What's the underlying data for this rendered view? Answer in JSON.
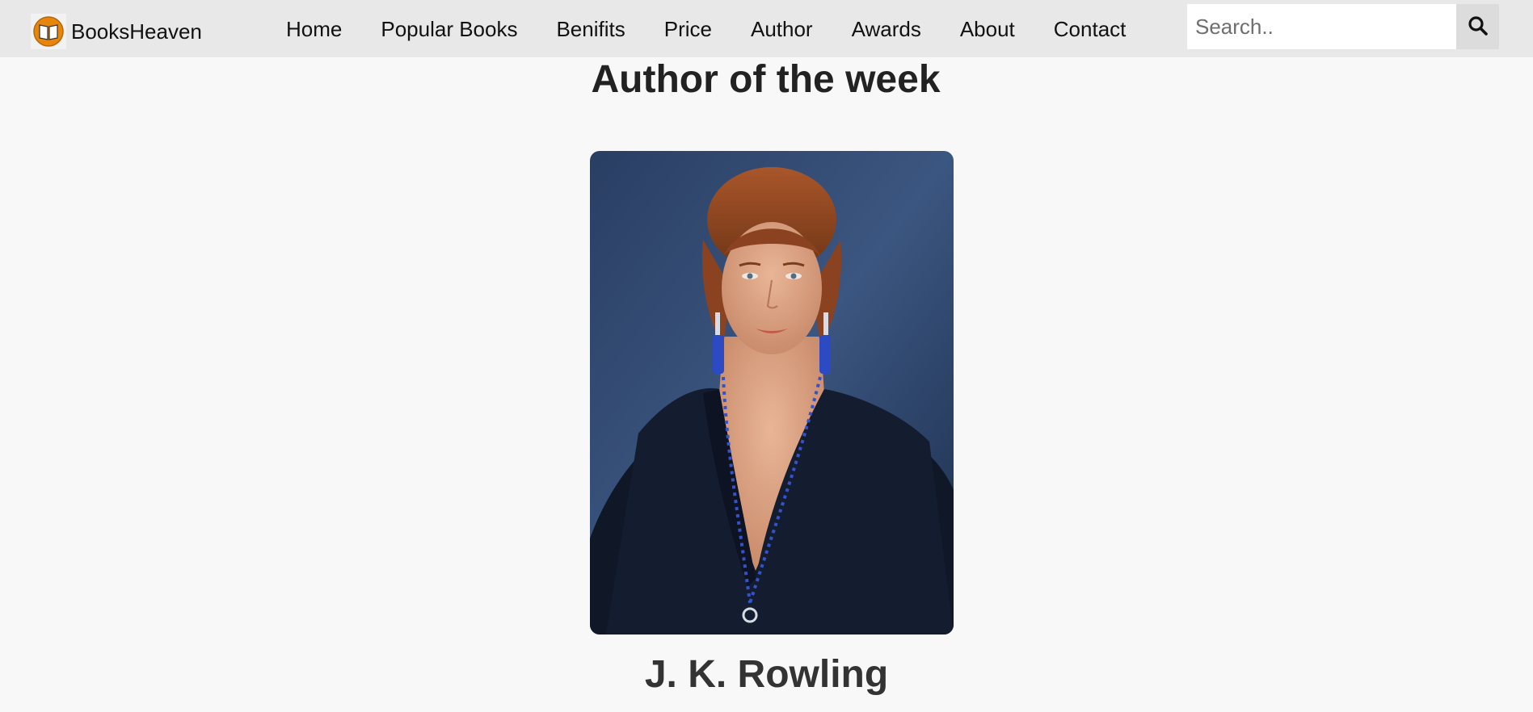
{
  "navbar": {
    "brand": {
      "name": "BooksHeaven",
      "logo_icon": "open-book-icon"
    },
    "links": [
      {
        "label": "Home"
      },
      {
        "label": "Popular Books"
      },
      {
        "label": "Benifits"
      },
      {
        "label": "Price"
      },
      {
        "label": "Author"
      },
      {
        "label": "Awards"
      },
      {
        "label": "About"
      },
      {
        "label": "Contact"
      }
    ],
    "search": {
      "value": "",
      "placeholder": "Search..",
      "button_icon": "search-icon"
    }
  },
  "author_section": {
    "title": "Author of the week",
    "author_name": "J. K. Rowling"
  },
  "colors": {
    "navbar_bg": "#e8e8e8",
    "page_bg": "#f8f8f8",
    "search_button_bg": "#dcdcdc",
    "logo_orange": "#e8860c"
  }
}
